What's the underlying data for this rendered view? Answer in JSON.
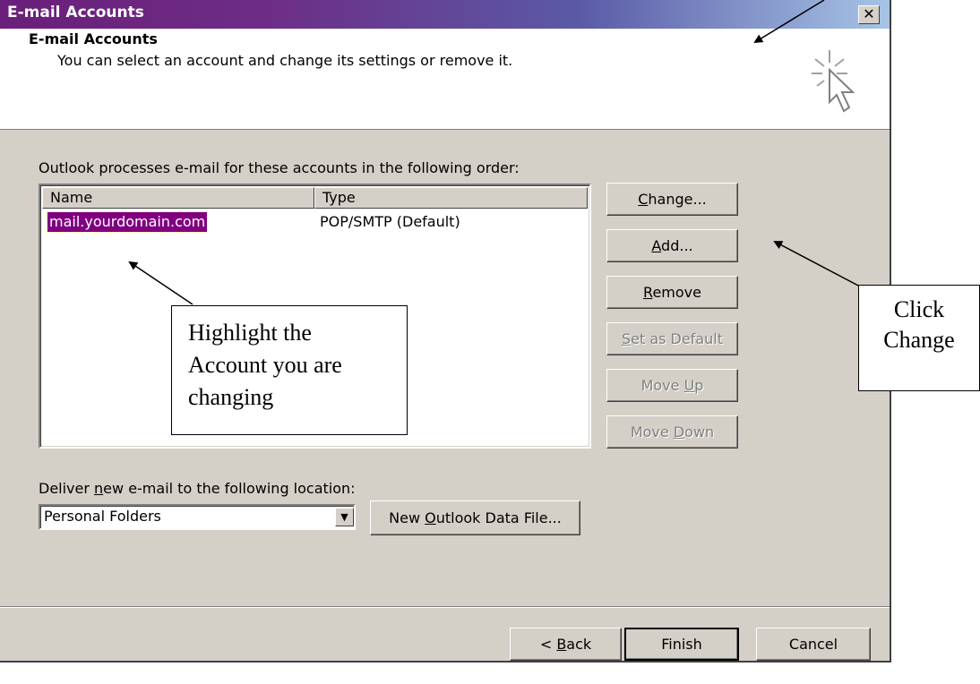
{
  "window": {
    "title": "E-mail Accounts",
    "close_glyph": "✕"
  },
  "header": {
    "title": "E-mail Accounts",
    "subtitle": "You can select an account and change its settings or remove it."
  },
  "accounts": {
    "label": "Outlook processes e-mail for these accounts in the following order:",
    "columns": [
      "Name",
      "Type"
    ],
    "rows": [
      {
        "name": "mail.yourdomain.com",
        "type": "POP/SMTP (Default)",
        "selected": true
      }
    ]
  },
  "side_buttons": {
    "change": "Change...",
    "add": "Add...",
    "remove": "Remove",
    "set_default": "Set as Default",
    "move_up": "Move Up",
    "move_down": "Move Down"
  },
  "deliver": {
    "label": "Deliver new e-mail to the following location:",
    "selected": "Personal Folders",
    "new_file_button": "New Outlook Data File..."
  },
  "footer": {
    "back": "< Back",
    "finish": "Finish",
    "cancel": "Cancel"
  },
  "callouts": {
    "highlight_line1": "Highlight the",
    "highlight_line2": "Account you are",
    "highlight_line3": "changing",
    "click_line1": "Click",
    "click_line2": "Change"
  },
  "colors": {
    "title_gradient_start": "#6a1f7a",
    "title_gradient_end": "#a6c4e6",
    "selection": "#800080",
    "dialog_face": "#d4d0c8"
  }
}
